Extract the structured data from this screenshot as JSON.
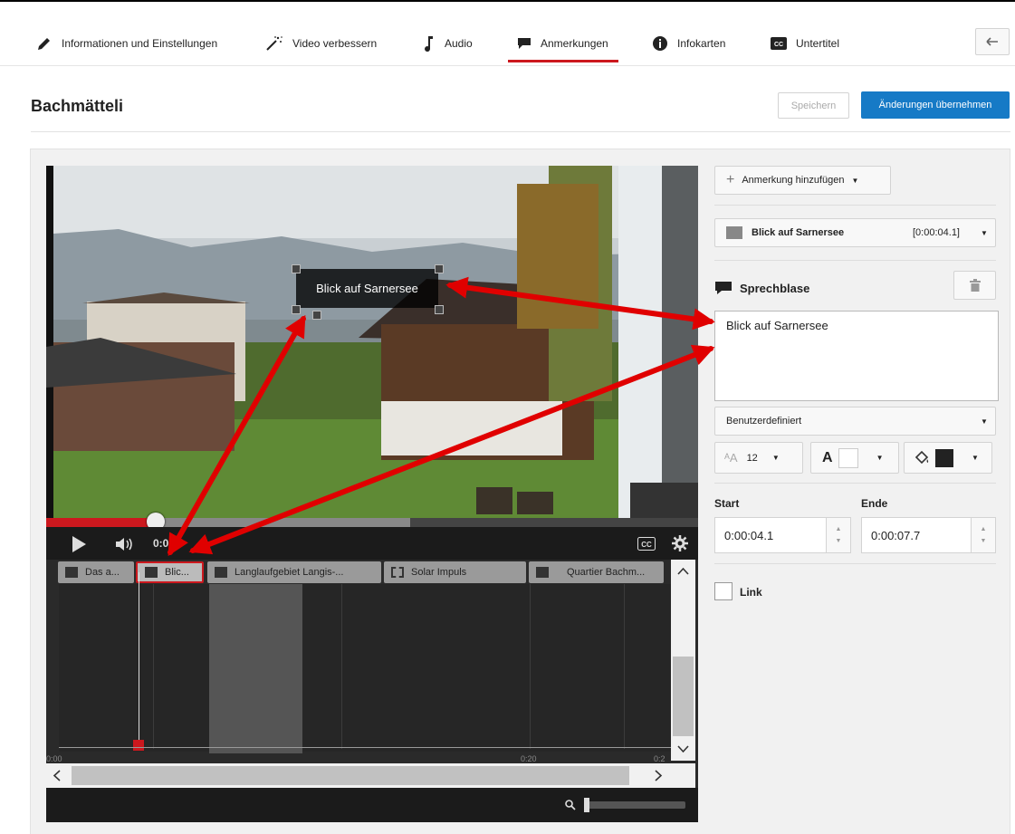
{
  "tabs": [
    {
      "label": "Informationen und Einstellungen",
      "icon": "pencil-icon"
    },
    {
      "label": "Video verbessern",
      "icon": "magic-wand-icon"
    },
    {
      "label": "Audio",
      "icon": "music-note-icon"
    },
    {
      "label": "Anmerkungen",
      "icon": "speech-bubble-icon",
      "active": true
    },
    {
      "label": "Infokarten",
      "icon": "info-icon"
    },
    {
      "label": "Untertitel",
      "icon": "cc-icon"
    }
  ],
  "header": {
    "title": "Bachmätteli",
    "save_label": "Speichern",
    "apply_label": "Änderungen übernehmen"
  },
  "video": {
    "annotation_text": "Blick auf Sarnersee",
    "time_display": "0:0  / 0",
    "progress_fraction": 0.17,
    "buffered_fraction": 0.56
  },
  "timeline": {
    "chips": [
      {
        "label": "Das a...",
        "selected": false
      },
      {
        "label": "Blic...",
        "selected": true
      },
      {
        "label": "Langlaufgebiet Langis-...",
        "selected": false
      },
      {
        "label": "Solar Impuls",
        "selected": false
      },
      {
        "label": "Quartier Bachm...",
        "selected": false
      }
    ],
    "tick_labels": [
      "0:00",
      "0:20",
      "0:2"
    ]
  },
  "right_panel": {
    "add_annotation_label": "Anmerkung hinzufügen",
    "selected_annotation": "Blick auf Sarnersee",
    "selected_annotation_time": "[0:00:04.1]",
    "type_label": "Sprechblase",
    "text_value": "Blick auf Sarnersee",
    "style_select": "Benutzerdefiniert",
    "font_size": "12",
    "text_color": "#ffffff",
    "background_color": "#222222",
    "start_label": "Start",
    "end_label": "Ende",
    "start_value": "0:00:04.1",
    "end_value": "0:00:07.7",
    "link_label": "Link"
  },
  "colors": {
    "accent_red": "#cc181e",
    "primary_blue": "#167ac6",
    "annotation_arrows": "#e00000"
  }
}
